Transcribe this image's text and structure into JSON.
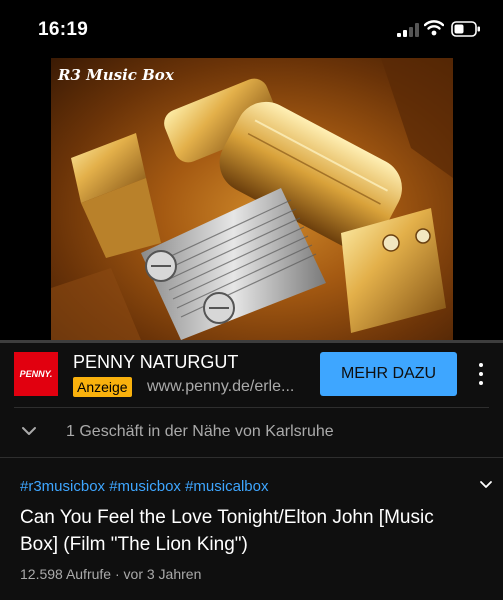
{
  "status_bar": {
    "time": "16:19"
  },
  "video": {
    "thumbnail_title": "R3 Music Box",
    "progress": 0.0
  },
  "ad": {
    "logo_text": "PENNY.",
    "title": "PENNY NATURGUT",
    "badge": "Anzeige",
    "url": "www.penny.de/erle...",
    "cta": "MEHR DAZU"
  },
  "nearby": {
    "text": "1 Geschäft in der Nähe von Karlsruhe"
  },
  "info": {
    "hashtags": [
      "#r3musicbox",
      "#musicbox",
      "#musicalbox"
    ],
    "title": "Can You Feel the Love Tonight/Elton John [Music Box] (Film \"The Lion King\")",
    "views": "12.598 Aufrufe",
    "separator": "·",
    "age": "vor 3 Jahren"
  },
  "colors": {
    "accent": "#3ea6ff",
    "badge": "#f9b10d",
    "brand": "#e1000f",
    "progress": "#ff0000"
  }
}
